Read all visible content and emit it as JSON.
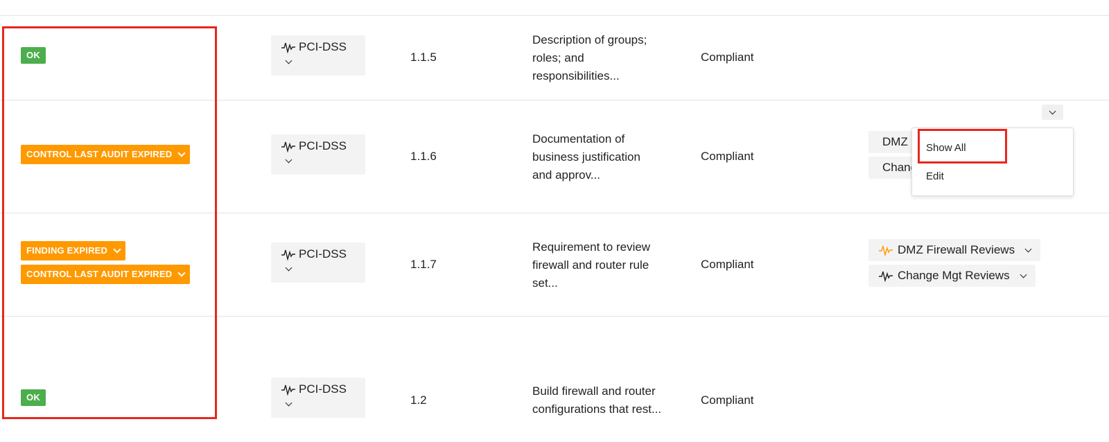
{
  "colors": {
    "ok_green": "#4cae4c",
    "warn_orange": "#ff9900",
    "chip_bg": "#f3f3f3",
    "highlight_red": "#e8261c"
  },
  "rows": [
    {
      "statuses": [
        {
          "label": "OK",
          "kind": "ok"
        }
      ],
      "framework": "PCI-DSS",
      "ref": "1.1.5",
      "description": [
        "Description of groups;",
        "roles; and",
        "responsibilities..."
      ],
      "status": "Compliant",
      "tags": []
    },
    {
      "statuses": [
        {
          "label": "CONTROL LAST AUDIT EXPIRED",
          "kind": "warn"
        }
      ],
      "framework": "PCI-DSS",
      "ref": "1.1.6",
      "description": [
        "Documentation of",
        "business justification",
        "and approv..."
      ],
      "status": "Compliant",
      "tags": [
        {
          "label": "DMZ Firewall Reviews",
          "icon": "pulse-orange-icon"
        },
        {
          "label": "Change Mgt Reviews",
          "icon": "pulse-black-icon"
        }
      ]
    },
    {
      "statuses": [
        {
          "label": "FINDING EXPIRED",
          "kind": "warn"
        },
        {
          "label": "CONTROL LAST AUDIT EXPIRED",
          "kind": "warn"
        }
      ],
      "framework": "PCI-DSS",
      "ref": "1.1.7",
      "description": [
        "Requirement to review",
        "firewall and router rule",
        "set..."
      ],
      "status": "Compliant",
      "tags": [
        {
          "label": "DMZ Firewall Reviews",
          "icon": "pulse-orange-icon"
        },
        {
          "label": "Change Mgt Reviews",
          "icon": "pulse-black-icon"
        }
      ]
    },
    {
      "statuses": [
        {
          "label": "OK",
          "kind": "ok"
        }
      ],
      "framework": "PCI-DSS",
      "ref": "1.2",
      "description": [
        "Build firewall and router",
        "configurations that rest..."
      ],
      "status": "Compliant",
      "tags": []
    }
  ],
  "dropdown_menu": {
    "items": [
      "Show All",
      "Edit"
    ]
  }
}
